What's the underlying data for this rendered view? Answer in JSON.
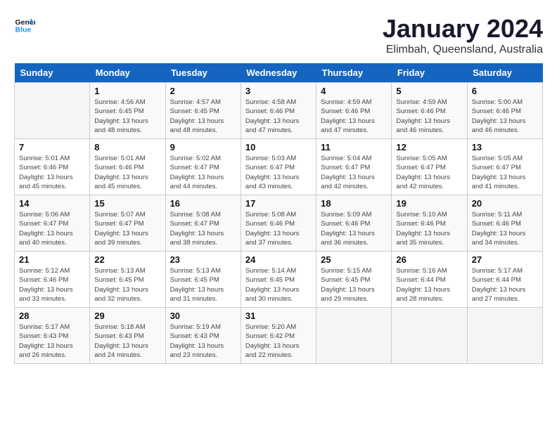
{
  "header": {
    "logo_line1": "General",
    "logo_line2": "Blue",
    "month": "January 2024",
    "location": "Elimbah, Queensland, Australia"
  },
  "weekdays": [
    "Sunday",
    "Monday",
    "Tuesday",
    "Wednesday",
    "Thursday",
    "Friday",
    "Saturday"
  ],
  "weeks": [
    [
      {
        "day": "",
        "info": ""
      },
      {
        "day": "1",
        "info": "Sunrise: 4:56 AM\nSunset: 6:45 PM\nDaylight: 13 hours\nand 48 minutes."
      },
      {
        "day": "2",
        "info": "Sunrise: 4:57 AM\nSunset: 6:45 PM\nDaylight: 13 hours\nand 48 minutes."
      },
      {
        "day": "3",
        "info": "Sunrise: 4:58 AM\nSunset: 6:46 PM\nDaylight: 13 hours\nand 47 minutes."
      },
      {
        "day": "4",
        "info": "Sunrise: 4:59 AM\nSunset: 6:46 PM\nDaylight: 13 hours\nand 47 minutes."
      },
      {
        "day": "5",
        "info": "Sunrise: 4:59 AM\nSunset: 6:46 PM\nDaylight: 13 hours\nand 46 minutes."
      },
      {
        "day": "6",
        "info": "Sunrise: 5:00 AM\nSunset: 6:46 PM\nDaylight: 13 hours\nand 46 minutes."
      }
    ],
    [
      {
        "day": "7",
        "info": "Sunrise: 5:01 AM\nSunset: 6:46 PM\nDaylight: 13 hours\nand 45 minutes."
      },
      {
        "day": "8",
        "info": "Sunrise: 5:01 AM\nSunset: 6:46 PM\nDaylight: 13 hours\nand 45 minutes."
      },
      {
        "day": "9",
        "info": "Sunrise: 5:02 AM\nSunset: 6:47 PM\nDaylight: 13 hours\nand 44 minutes."
      },
      {
        "day": "10",
        "info": "Sunrise: 5:03 AM\nSunset: 6:47 PM\nDaylight: 13 hours\nand 43 minutes."
      },
      {
        "day": "11",
        "info": "Sunrise: 5:04 AM\nSunset: 6:47 PM\nDaylight: 13 hours\nand 42 minutes."
      },
      {
        "day": "12",
        "info": "Sunrise: 5:05 AM\nSunset: 6:47 PM\nDaylight: 13 hours\nand 42 minutes."
      },
      {
        "day": "13",
        "info": "Sunrise: 5:05 AM\nSunset: 6:47 PM\nDaylight: 13 hours\nand 41 minutes."
      }
    ],
    [
      {
        "day": "14",
        "info": "Sunrise: 5:06 AM\nSunset: 6:47 PM\nDaylight: 13 hours\nand 40 minutes."
      },
      {
        "day": "15",
        "info": "Sunrise: 5:07 AM\nSunset: 6:47 PM\nDaylight: 13 hours\nand 39 minutes."
      },
      {
        "day": "16",
        "info": "Sunrise: 5:08 AM\nSunset: 6:47 PM\nDaylight: 13 hours\nand 38 minutes."
      },
      {
        "day": "17",
        "info": "Sunrise: 5:08 AM\nSunset: 6:46 PM\nDaylight: 13 hours\nand 37 minutes."
      },
      {
        "day": "18",
        "info": "Sunrise: 5:09 AM\nSunset: 6:46 PM\nDaylight: 13 hours\nand 36 minutes."
      },
      {
        "day": "19",
        "info": "Sunrise: 5:10 AM\nSunset: 6:46 PM\nDaylight: 13 hours\nand 35 minutes."
      },
      {
        "day": "20",
        "info": "Sunrise: 5:11 AM\nSunset: 6:46 PM\nDaylight: 13 hours\nand 34 minutes."
      }
    ],
    [
      {
        "day": "21",
        "info": "Sunrise: 5:12 AM\nSunset: 6:46 PM\nDaylight: 13 hours\nand 33 minutes."
      },
      {
        "day": "22",
        "info": "Sunrise: 5:13 AM\nSunset: 6:45 PM\nDaylight: 13 hours\nand 32 minutes."
      },
      {
        "day": "23",
        "info": "Sunrise: 5:13 AM\nSunset: 6:45 PM\nDaylight: 13 hours\nand 31 minutes."
      },
      {
        "day": "24",
        "info": "Sunrise: 5:14 AM\nSunset: 6:45 PM\nDaylight: 13 hours\nand 30 minutes."
      },
      {
        "day": "25",
        "info": "Sunrise: 5:15 AM\nSunset: 6:45 PM\nDaylight: 13 hours\nand 29 minutes."
      },
      {
        "day": "26",
        "info": "Sunrise: 5:16 AM\nSunset: 6:44 PM\nDaylight: 13 hours\nand 28 minutes."
      },
      {
        "day": "27",
        "info": "Sunrise: 5:17 AM\nSunset: 6:44 PM\nDaylight: 13 hours\nand 27 minutes."
      }
    ],
    [
      {
        "day": "28",
        "info": "Sunrise: 5:17 AM\nSunset: 6:43 PM\nDaylight: 13 hours\nand 26 minutes."
      },
      {
        "day": "29",
        "info": "Sunrise: 5:18 AM\nSunset: 6:43 PM\nDaylight: 13 hours\nand 24 minutes."
      },
      {
        "day": "30",
        "info": "Sunrise: 5:19 AM\nSunset: 6:43 PM\nDaylight: 13 hours\nand 23 minutes."
      },
      {
        "day": "31",
        "info": "Sunrise: 5:20 AM\nSunset: 6:42 PM\nDaylight: 13 hours\nand 22 minutes."
      },
      {
        "day": "",
        "info": ""
      },
      {
        "day": "",
        "info": ""
      },
      {
        "day": "",
        "info": ""
      }
    ]
  ]
}
